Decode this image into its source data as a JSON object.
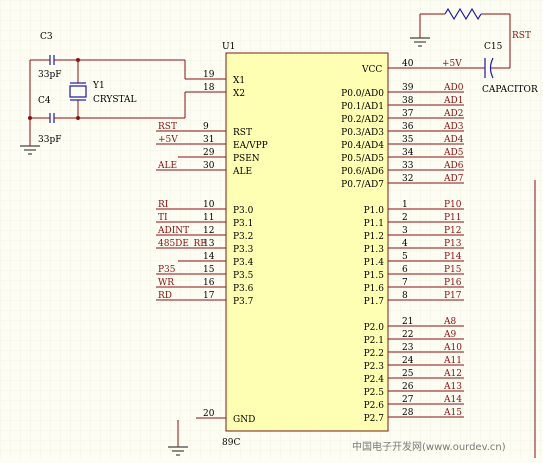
{
  "title": "",
  "colors": {
    "background": "#fdfdf3",
    "grid": "#e6e6d6",
    "chip_fill": "#ffffb3",
    "chip_border": "#7a1a1a",
    "wire": "#8b1010",
    "net_label": "#8b1010",
    "component": "#1a1aa0",
    "ground": "#444444",
    "text": "#000000",
    "junction": "#8b1010"
  },
  "chip": {
    "ref": "U1",
    "type": "89C",
    "vcc_label": "VCC"
  },
  "left_pins": [
    {
      "num": "19",
      "name": "X1",
      "net": ""
    },
    {
      "num": "18",
      "name": "X2",
      "net": ""
    },
    {
      "num": "9",
      "name": "RST",
      "net": "RST"
    },
    {
      "num": "31",
      "name": "EA/VPP",
      "net": "+5V"
    },
    {
      "num": "29",
      "name": "PSEN",
      "net": ""
    },
    {
      "num": "30",
      "name": "ALE",
      "net": "ALE"
    },
    {
      "num": "10",
      "name": "P3.0",
      "net": "RI"
    },
    {
      "num": "11",
      "name": "P3.1",
      "net": "TI"
    },
    {
      "num": "12",
      "name": "P3.2",
      "net": "ADINT"
    },
    {
      "num": "13",
      "name": "P3.3",
      "net": "485DE_RE"
    },
    {
      "num": "14",
      "name": "P3.4",
      "net": ""
    },
    {
      "num": "15",
      "name": "P3.5",
      "net": "P35"
    },
    {
      "num": "16",
      "name": "P3.6",
      "net": "WR"
    },
    {
      "num": "17",
      "name": "P3.7",
      "net": "RD"
    },
    {
      "num": "20",
      "name": "GND",
      "net": ""
    }
  ],
  "right_pins": [
    {
      "num": "40",
      "name": "VCC",
      "net": "+5V"
    },
    {
      "num": "39",
      "name": "P0.0/AD0",
      "net": "AD0"
    },
    {
      "num": "38",
      "name": "P0.1/AD1",
      "net": "AD1"
    },
    {
      "num": "37",
      "name": "P0.2/AD2",
      "net": "AD2"
    },
    {
      "num": "36",
      "name": "P0.3/AD3",
      "net": "AD3"
    },
    {
      "num": "35",
      "name": "P0.4/AD4",
      "net": "AD4"
    },
    {
      "num": "34",
      "name": "P0.5/AD5",
      "net": "AD5"
    },
    {
      "num": "33",
      "name": "P0.6/AD6",
      "net": "AD6"
    },
    {
      "num": "32",
      "name": "P0.7/AD7",
      "net": "AD7"
    },
    {
      "num": "1",
      "name": "P1.0",
      "net": "P10"
    },
    {
      "num": "2",
      "name": "P1.1",
      "net": "P11"
    },
    {
      "num": "3",
      "name": "P1.2",
      "net": "P12"
    },
    {
      "num": "4",
      "name": "P1.3",
      "net": "P13"
    },
    {
      "num": "5",
      "name": "P1.4",
      "net": "P14"
    },
    {
      "num": "6",
      "name": "P1.5",
      "net": "P15"
    },
    {
      "num": "7",
      "name": "P1.6",
      "net": "P16"
    },
    {
      "num": "8",
      "name": "P1.7",
      "net": "P17"
    },
    {
      "num": "21",
      "name": "P2.0",
      "net": "A8"
    },
    {
      "num": "22",
      "name": "P2.1",
      "net": "A9"
    },
    {
      "num": "23",
      "name": "P2.2",
      "net": "A10"
    },
    {
      "num": "24",
      "name": "P2.3",
      "net": "A11"
    },
    {
      "num": "25",
      "name": "P2.4",
      "net": "A12"
    },
    {
      "num": "26",
      "name": "P2.5",
      "net": "A13"
    },
    {
      "num": "27",
      "name": "P2.6",
      "net": "A14"
    },
    {
      "num": "28",
      "name": "P2.7",
      "net": "A15"
    }
  ],
  "components": {
    "c3": {
      "ref": "C3",
      "value": "33pF"
    },
    "c4": {
      "ref": "C4",
      "value": "33pF"
    },
    "y1": {
      "ref": "Y1",
      "value": "CRYSTAL"
    },
    "c15": {
      "ref": "C15",
      "value": "CAPACITOR"
    },
    "rst_net": "RST"
  },
  "watermark": "中国电子开发网(www.ourdev.cn)"
}
